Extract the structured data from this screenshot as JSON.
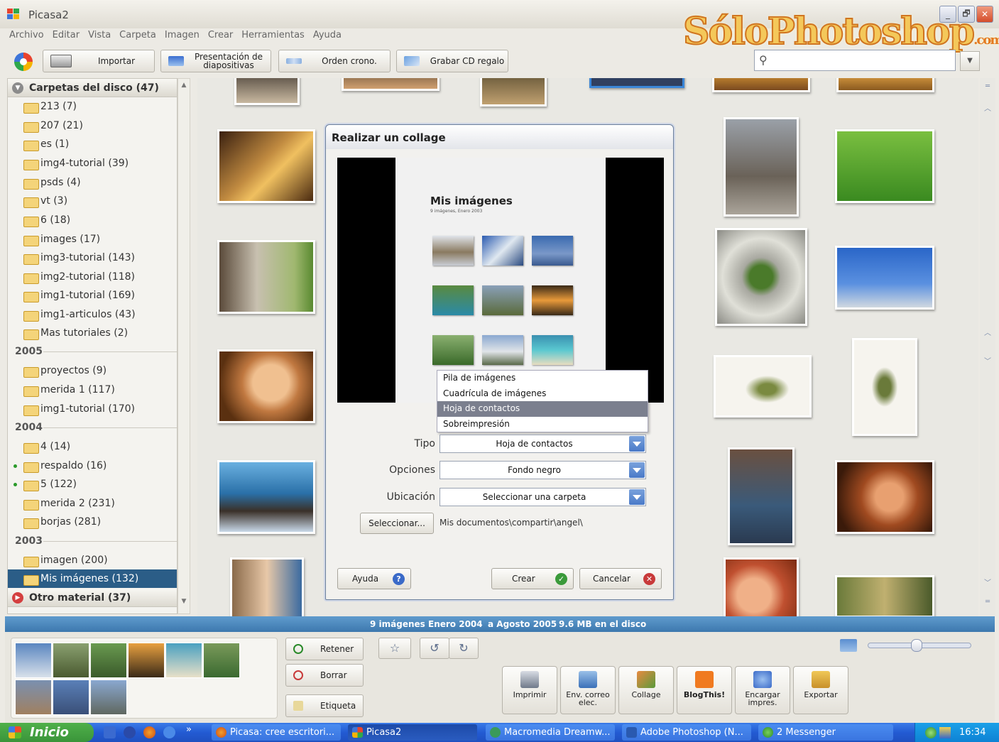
{
  "app": {
    "title": "Picasa2",
    "watermark": "SóloPhotoshop",
    "watermark_suffix": ".com"
  },
  "window_buttons": {
    "minimize": "_",
    "restore": "🗗",
    "close": "✕"
  },
  "menu": [
    "Archivo",
    "Editar",
    "Vista",
    "Carpeta",
    "Imagen",
    "Crear",
    "Herramientas",
    "Ayuda"
  ],
  "toolbar": {
    "import": "Importar",
    "slideshow": "Presentación de diapositivas",
    "timeline": "Orden crono.",
    "burn_cd": "Grabar CD regalo"
  },
  "sidebar": {
    "disk_folders_header": "Carpetas del disco (47)",
    "folders_top": [
      "213 (7)",
      "207 (21)",
      "es (1)",
      "img4-tutorial (39)",
      "psds (4)",
      "vt (3)",
      "6 (18)",
      "images (17)",
      "img3-tutorial (143)",
      "img2-tutorial (118)",
      "img1-tutorial (169)",
      "img1-articulos (43)",
      "Mas tutoriales (2)"
    ],
    "year_2005": "2005",
    "folders_2005": [
      "proyectos (9)",
      "merida 1 (117)",
      "img1-tutorial (170)"
    ],
    "year_2004": "2004",
    "folders_2004": [
      "4 (14)",
      "respaldo (16)",
      "5 (122)",
      "merida 2 (231)",
      "borjas (281)"
    ],
    "year_2003": "2003",
    "folders_2003": [
      "imagen (200)",
      "Mis imágenes (132)"
    ],
    "other_header": "Otro material (37)"
  },
  "status": {
    "count": "9 imágenes",
    "from": "Enero 2004",
    "to": "a Agosto 2005",
    "size": "9.6 MB en el disco"
  },
  "tray": {
    "hold": "Retener",
    "clear": "Borrar",
    "label": "Etiqueta",
    "actions": [
      "Imprimir",
      "Env. correo elec.",
      "Collage",
      "BlogThis!",
      "Encargar impres.",
      "Exportar"
    ]
  },
  "dialog": {
    "title": "Realizar un collage",
    "preview_title": "Mis imágenes",
    "preview_subtitle": "9 imágenes, Enero 2003",
    "dropdown_options": [
      "Pila de imágenes",
      "Cuadrícula de imágenes",
      "Hoja de contactos",
      "Sobreimpresión"
    ],
    "type_label": "Tipo",
    "type_value": "Hoja de contactos",
    "options_label": "Opciones",
    "options_value": "Fondo negro",
    "location_label": "Ubicación",
    "location_value": "Seleccionar una carpeta",
    "select_button": "Seleccionar...",
    "path": "Mis documentos\\compartir\\angel\\",
    "help": "Ayuda",
    "create": "Crear",
    "cancel": "Cancelar"
  },
  "taskbar": {
    "start": "Inicio",
    "overflow": "»",
    "tasks": [
      "Picasa: cree escritori...",
      "Picasa2",
      "Macromedia Dreamw...",
      "Adobe Photoshop (N...",
      "2 Messenger"
    ],
    "clock": "16:34"
  }
}
